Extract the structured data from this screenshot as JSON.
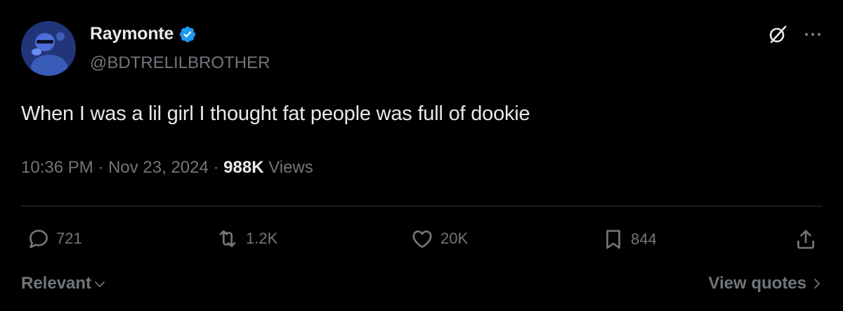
{
  "author": {
    "display_name": "Raymonte",
    "handle": "@BDTRELILBROTHER",
    "verified": true,
    "verified_color": "#1d9bf0"
  },
  "top_actions": {
    "grok_icon": "grok-icon",
    "more_icon": "more-icon"
  },
  "tweet": {
    "text": "When I was a lil girl I thought fat people was full of dookie"
  },
  "meta": {
    "time": "10:36 PM",
    "separator": " · ",
    "date": "Nov 23, 2024",
    "views_count": "988K",
    "views_label": " Views"
  },
  "actions": {
    "replies": "721",
    "reposts": "1.2K",
    "likes": "20K",
    "bookmarks": "844"
  },
  "footer": {
    "sort_label": "Relevant",
    "view_quotes_label": "View quotes"
  },
  "colors": {
    "background": "#000000",
    "text_primary": "#e7e9ea",
    "text_secondary": "#71767b",
    "divider": "#2f3336"
  }
}
